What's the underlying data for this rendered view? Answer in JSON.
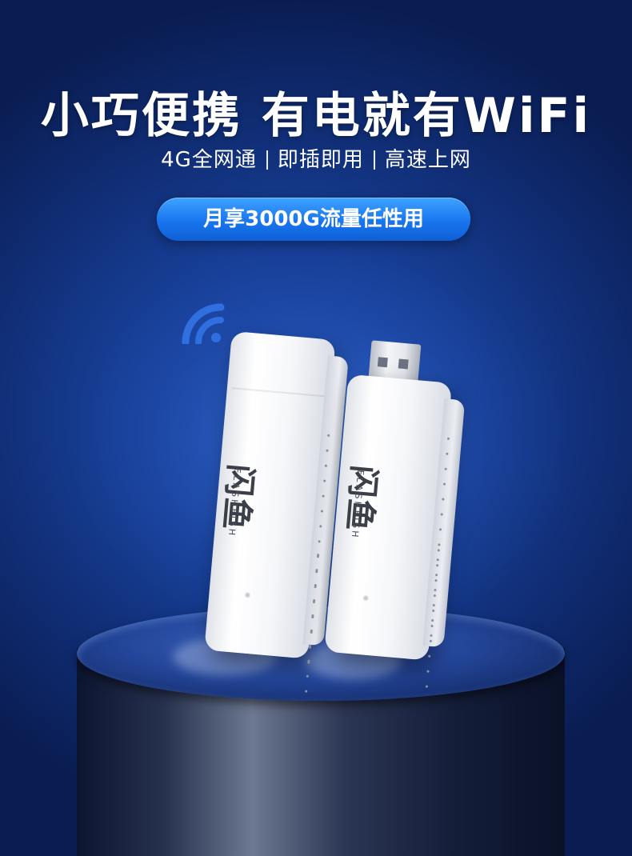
{
  "headline": "小巧便携 有电就有WiFi",
  "features": [
    "4G全网通",
    "即插即用",
    "高速上网"
  ],
  "promo_badge": "月享3000G流量任性用",
  "product": {
    "brand_logo": "闪鱼",
    "brand_name": "FLASHFISH"
  },
  "colors": {
    "background": "#173f97",
    "badge": "#1976ee",
    "text": "#ffffff",
    "device": "#f6f7fa"
  },
  "icons": [
    "wifi-signal-icon"
  ]
}
